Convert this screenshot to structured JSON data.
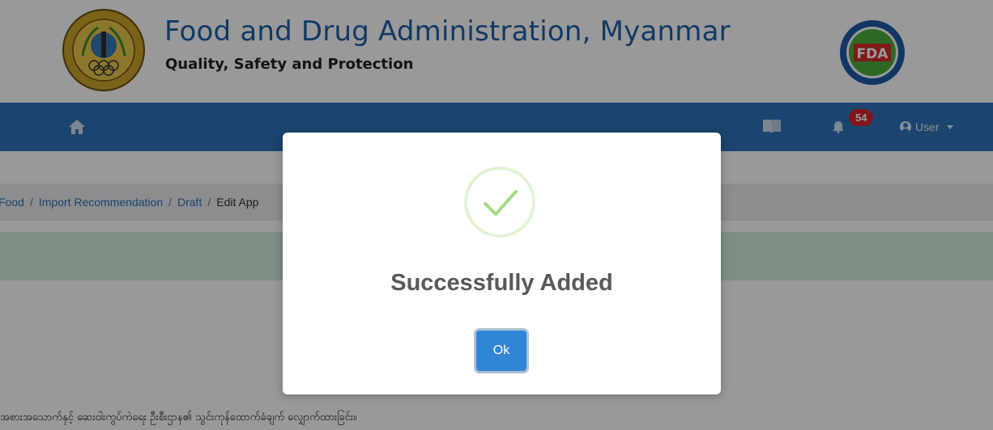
{
  "header": {
    "title": "Food and Drug Administration, Myanmar",
    "subtitle": "Quality, Safety and Protection",
    "right_logo_text": "FDA"
  },
  "navbar": {
    "notification_count": "54",
    "user_label": "User"
  },
  "breadcrumb": {
    "items": [
      "Food",
      "Import Recommendation",
      "Draft",
      "Edit App"
    ]
  },
  "footer": {
    "text": "အစားအသောက်နှင့် ဆေးဝါးကွပ်ကဲရေး ဦးစီးဌာန၏ သွင်းကုန်ထောက်ခံချက် လျှောက်ထားခြင်း။"
  },
  "modal": {
    "title": "Successfully Added",
    "ok_label": "Ok"
  },
  "colors": {
    "navbar": "#2e73b7",
    "title": "#1f5fa8",
    "badge": "#d9252a",
    "ok_button": "#3085d6",
    "success_check": "#a5dc86",
    "alert_bg": "#d4edda"
  }
}
